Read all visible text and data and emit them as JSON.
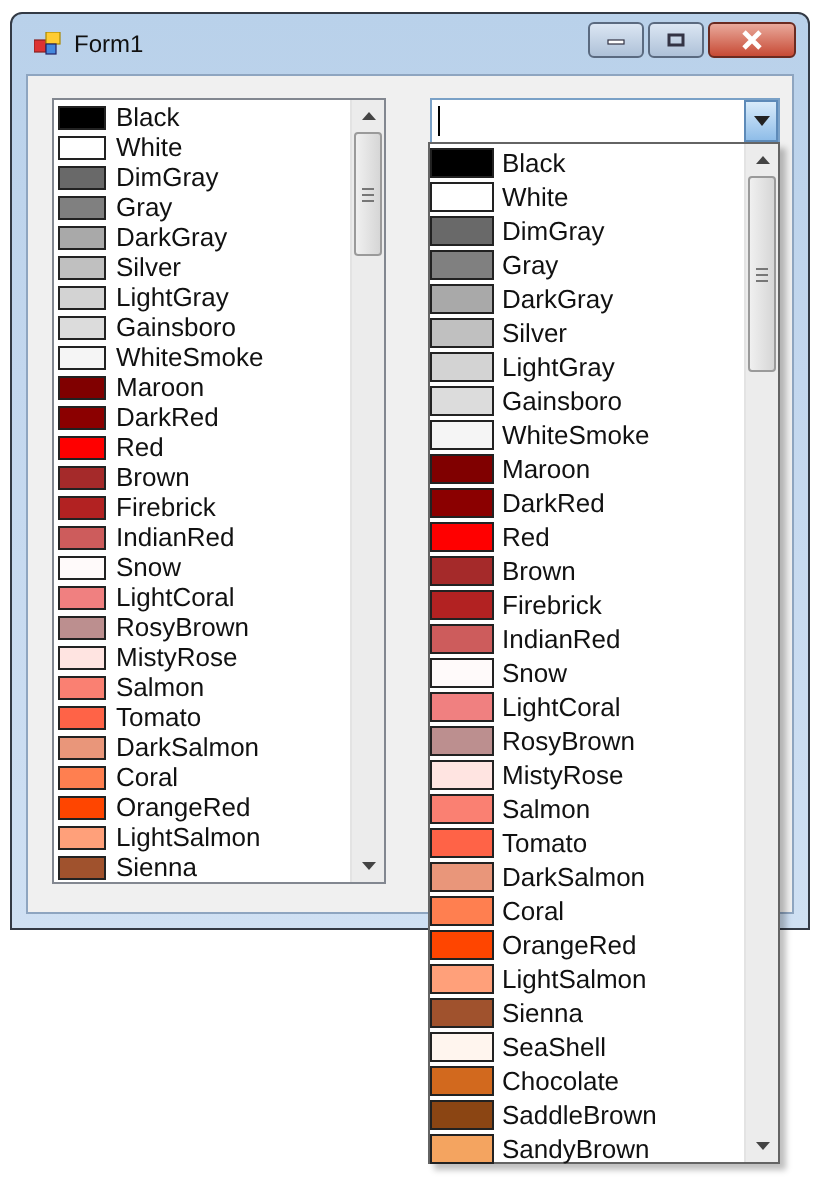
{
  "window": {
    "title": "Form1"
  },
  "list_box": {
    "items": [
      {
        "name": "Black",
        "color": "#000000"
      },
      {
        "name": "White",
        "color": "#ffffff"
      },
      {
        "name": "DimGray",
        "color": "#696969"
      },
      {
        "name": "Gray",
        "color": "#808080"
      },
      {
        "name": "DarkGray",
        "color": "#a9a9a9"
      },
      {
        "name": "Silver",
        "color": "#c0c0c0"
      },
      {
        "name": "LightGray",
        "color": "#d3d3d3"
      },
      {
        "name": "Gainsboro",
        "color": "#dcdcdc"
      },
      {
        "name": "WhiteSmoke",
        "color": "#f5f5f5"
      },
      {
        "name": "Maroon",
        "color": "#800000"
      },
      {
        "name": "DarkRed",
        "color": "#8b0000"
      },
      {
        "name": "Red",
        "color": "#ff0000"
      },
      {
        "name": "Brown",
        "color": "#a52a2a"
      },
      {
        "name": "Firebrick",
        "color": "#b22222"
      },
      {
        "name": "IndianRed",
        "color": "#cd5c5c"
      },
      {
        "name": "Snow",
        "color": "#fffafa"
      },
      {
        "name": "LightCoral",
        "color": "#f08080"
      },
      {
        "name": "RosyBrown",
        "color": "#bc8f8f"
      },
      {
        "name": "MistyRose",
        "color": "#ffe4e1"
      },
      {
        "name": "Salmon",
        "color": "#fa8072"
      },
      {
        "name": "Tomato",
        "color": "#ff6347"
      },
      {
        "name": "DarkSalmon",
        "color": "#e9967a"
      },
      {
        "name": "Coral",
        "color": "#ff7f50"
      },
      {
        "name": "OrangeRed",
        "color": "#ff4500"
      },
      {
        "name": "LightSalmon",
        "color": "#ffa07a"
      },
      {
        "name": "Sienna",
        "color": "#a0522d"
      }
    ]
  },
  "combo_box": {
    "expanded": true,
    "items": [
      {
        "name": "Black",
        "color": "#000000"
      },
      {
        "name": "White",
        "color": "#ffffff"
      },
      {
        "name": "DimGray",
        "color": "#696969"
      },
      {
        "name": "Gray",
        "color": "#808080"
      },
      {
        "name": "DarkGray",
        "color": "#a9a9a9"
      },
      {
        "name": "Silver",
        "color": "#c0c0c0"
      },
      {
        "name": "LightGray",
        "color": "#d3d3d3"
      },
      {
        "name": "Gainsboro",
        "color": "#dcdcdc"
      },
      {
        "name": "WhiteSmoke",
        "color": "#f5f5f5"
      },
      {
        "name": "Maroon",
        "color": "#800000"
      },
      {
        "name": "DarkRed",
        "color": "#8b0000"
      },
      {
        "name": "Red",
        "color": "#ff0000"
      },
      {
        "name": "Brown",
        "color": "#a52a2a"
      },
      {
        "name": "Firebrick",
        "color": "#b22222"
      },
      {
        "name": "IndianRed",
        "color": "#cd5c5c"
      },
      {
        "name": "Snow",
        "color": "#fffafa"
      },
      {
        "name": "LightCoral",
        "color": "#f08080"
      },
      {
        "name": "RosyBrown",
        "color": "#bc8f8f"
      },
      {
        "name": "MistyRose",
        "color": "#ffe4e1"
      },
      {
        "name": "Salmon",
        "color": "#fa8072"
      },
      {
        "name": "Tomato",
        "color": "#ff6347"
      },
      {
        "name": "DarkSalmon",
        "color": "#e9967a"
      },
      {
        "name": "Coral",
        "color": "#ff7f50"
      },
      {
        "name": "OrangeRed",
        "color": "#ff4500"
      },
      {
        "name": "LightSalmon",
        "color": "#ffa07a"
      },
      {
        "name": "Sienna",
        "color": "#a0522d"
      },
      {
        "name": "SeaShell",
        "color": "#fff5ee"
      },
      {
        "name": "Chocolate",
        "color": "#d2691e"
      },
      {
        "name": "SaddleBrown",
        "color": "#8b4513"
      },
      {
        "name": "SandyBrown",
        "color": "#f4a460"
      }
    ]
  }
}
